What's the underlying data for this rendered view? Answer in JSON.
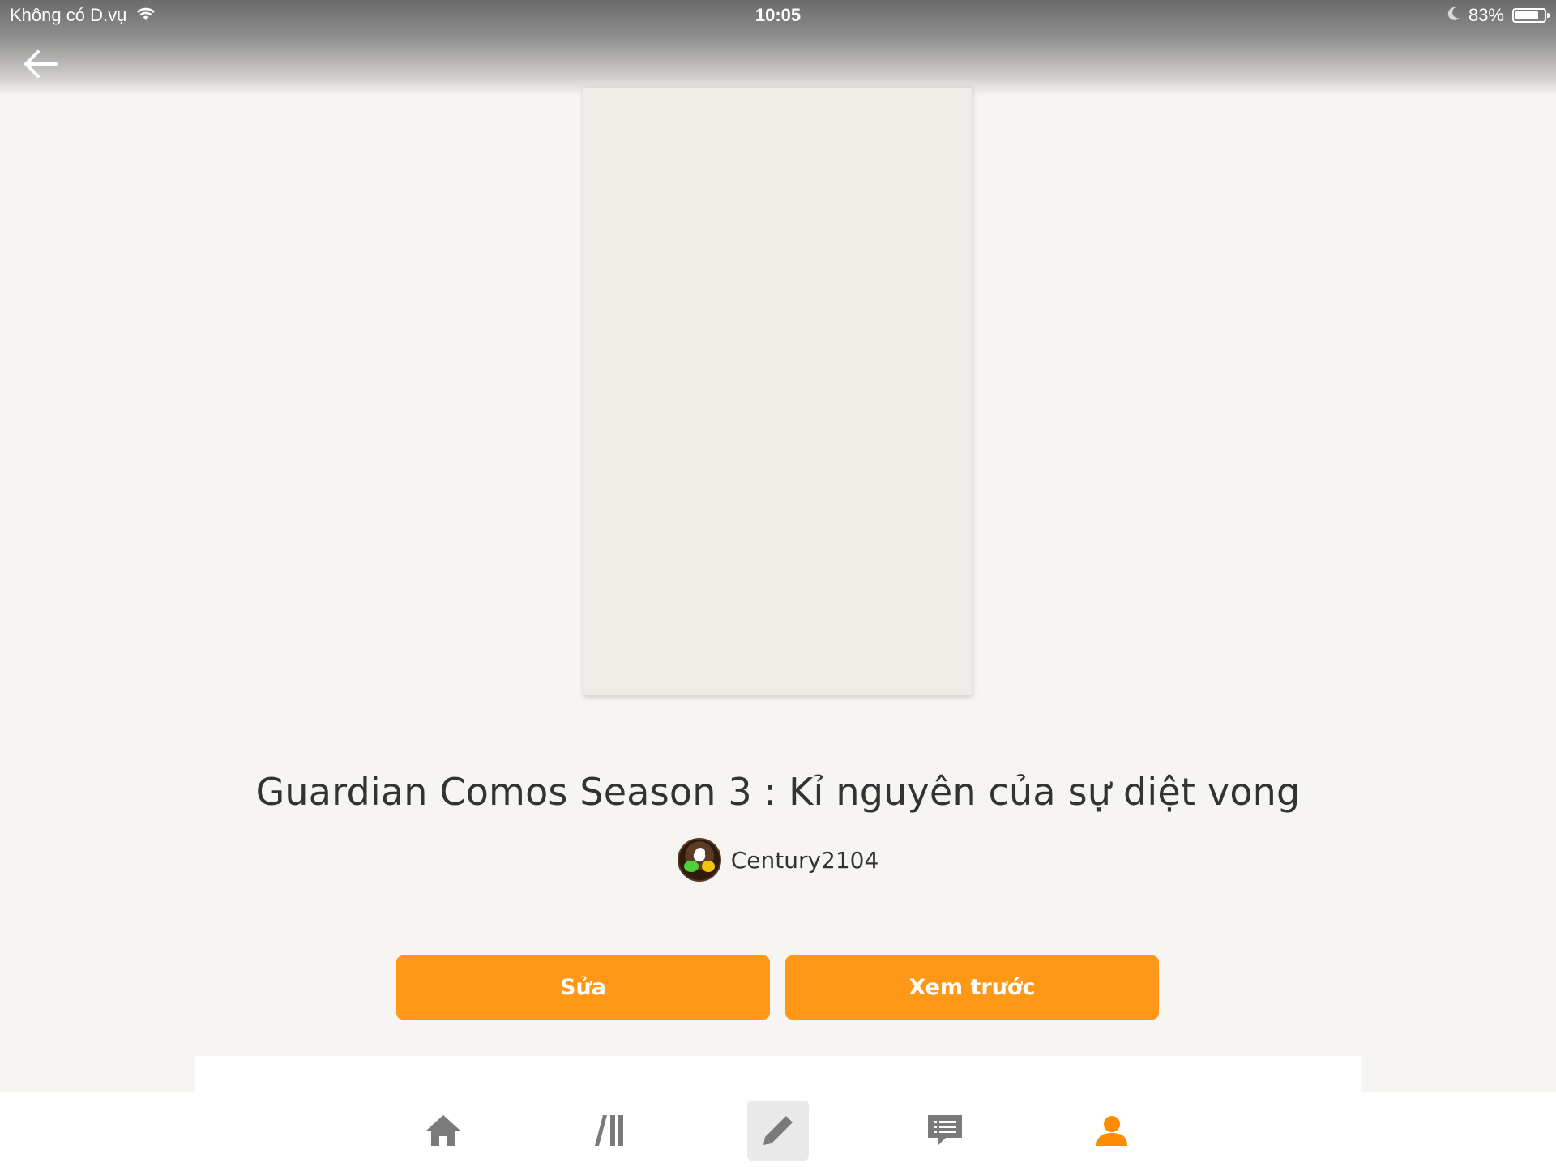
{
  "status_bar": {
    "carrier": "Không có D.vụ",
    "time": "10:05",
    "battery_percent": "83%",
    "battery_level": 0.83
  },
  "story": {
    "title": "Guardian Comos Season 3 : Kỉ nguyên của sự diệt vong",
    "author": "Century2104"
  },
  "actions": {
    "edit_label": "Sửa",
    "preview_label": "Xem trước"
  },
  "tab_bar": {
    "items": [
      {
        "icon": "home-icon"
      },
      {
        "icon": "library-icon"
      },
      {
        "icon": "pencil-icon",
        "active": true
      },
      {
        "icon": "chat-icon"
      },
      {
        "icon": "profile-icon"
      }
    ]
  },
  "colors": {
    "accent": "#ff9816",
    "background": "#f7f5f1",
    "cover_placeholder": "#edece6",
    "icon_gray": "#7a7a7a",
    "icon_active_orange": "#ff8c00"
  }
}
